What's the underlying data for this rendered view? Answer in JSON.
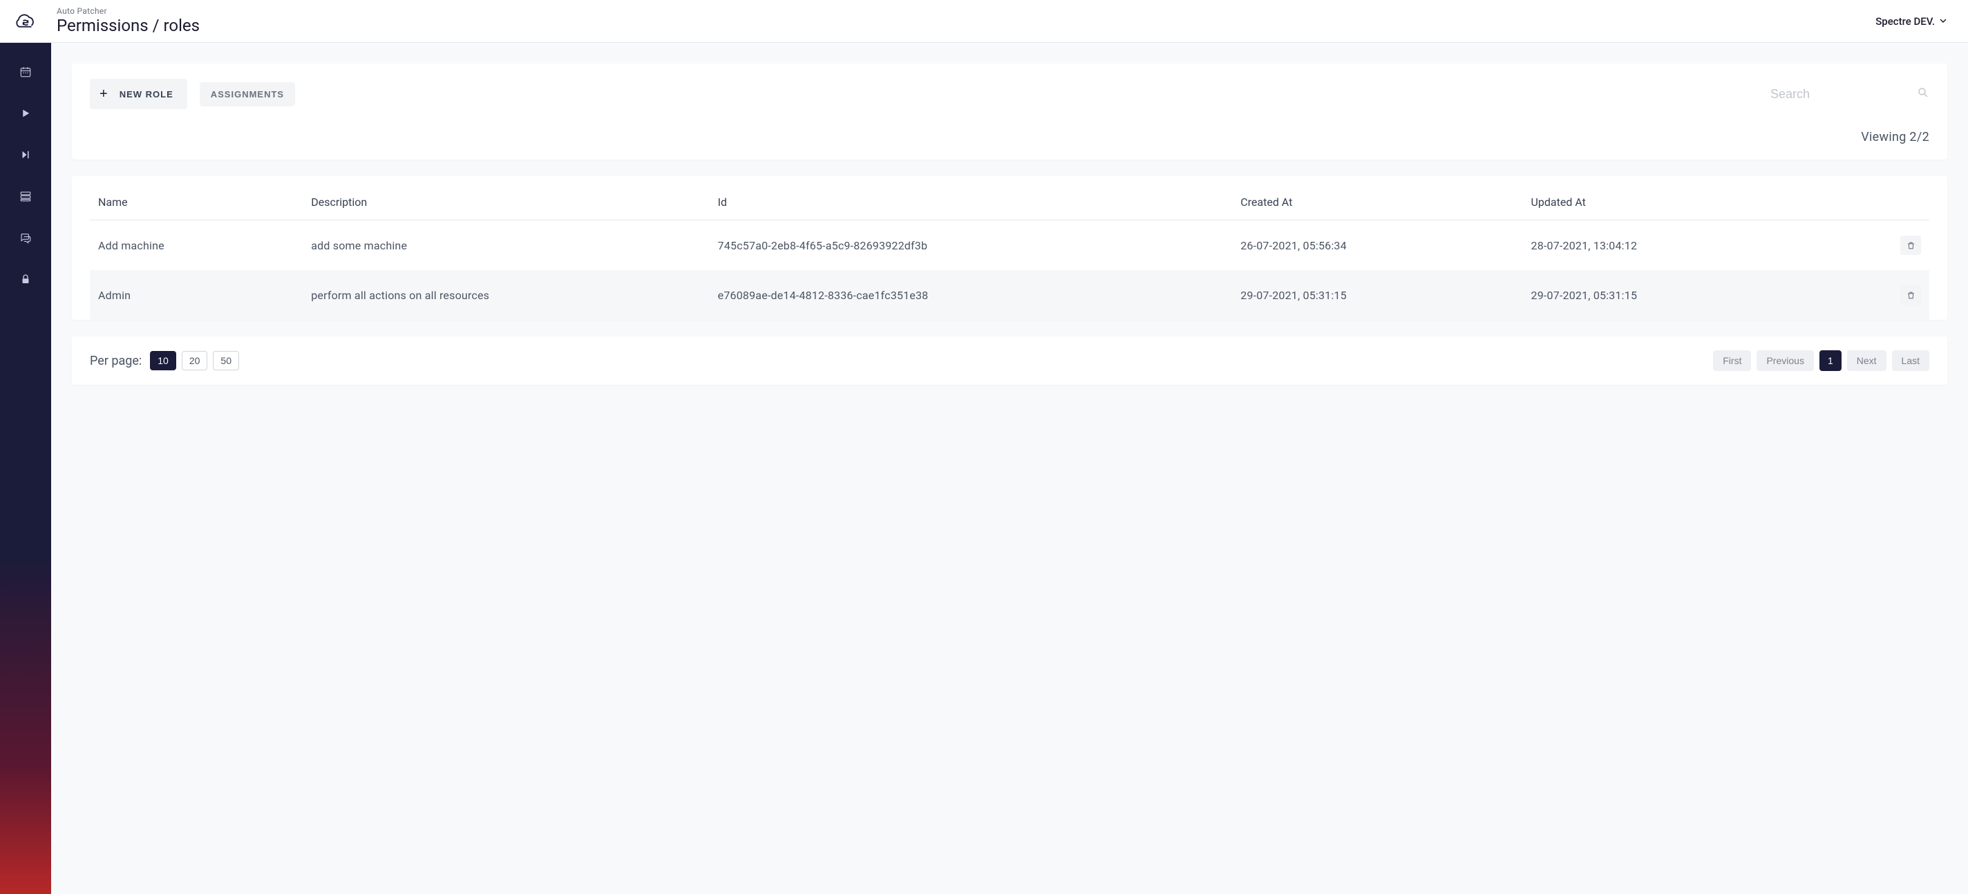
{
  "header": {
    "app_name": "Auto Patcher",
    "page_title": "Permissions / roles",
    "org_label": "Spectre DEV."
  },
  "toolbar": {
    "new_role_label": "NEW ROLE",
    "assignments_label": "ASSIGNMENTS",
    "search_placeholder": "Search"
  },
  "viewing_label": "Viewing 2/2",
  "table": {
    "columns": {
      "name": "Name",
      "description": "Description",
      "id": "Id",
      "created_at": "Created At",
      "updated_at": "Updated At"
    },
    "rows": [
      {
        "name": "Add machine",
        "description": "add some machine",
        "id": "745c57a0-2eb8-4f65-a5c9-82693922df3b",
        "created_at": "26-07-2021, 05:56:34",
        "updated_at": "28-07-2021, 13:04:12"
      },
      {
        "name": "Admin",
        "description": "perform all actions on all resources",
        "id": "e76089ae-de14-4812-8336-cae1fc351e38",
        "created_at": "29-07-2021, 05:31:15",
        "updated_at": "29-07-2021, 05:31:15"
      }
    ]
  },
  "pagination": {
    "per_page_label": "Per page:",
    "per_page_options": [
      "10",
      "20",
      "50"
    ],
    "per_page_active": "10",
    "first": "First",
    "previous": "Previous",
    "current": "1",
    "next": "Next",
    "last": "Last"
  }
}
